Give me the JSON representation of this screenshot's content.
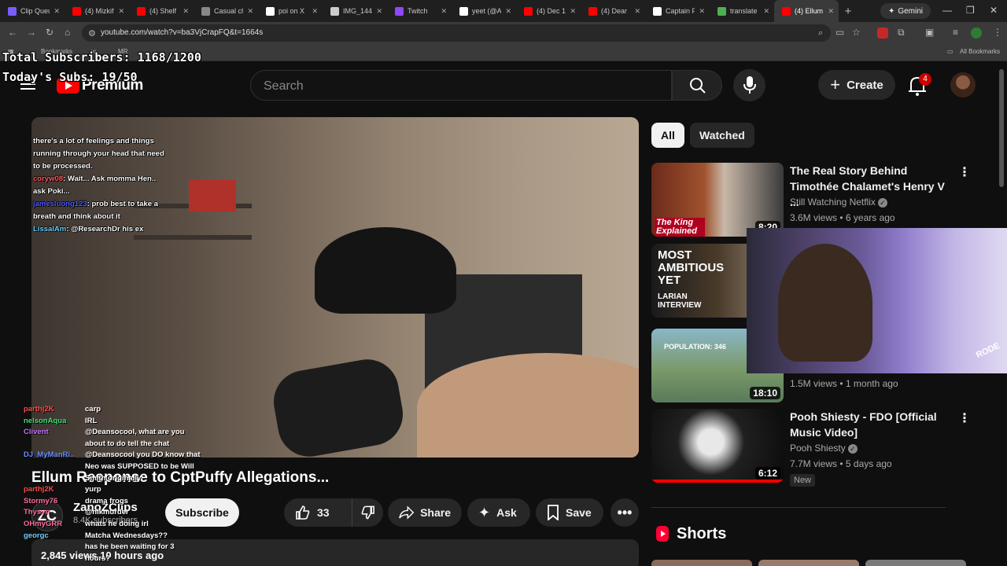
{
  "browser": {
    "tabs": [
      {
        "label": "Clip Queue",
        "color": "#7b5cff"
      },
      {
        "label": "(4) Mizkif",
        "color": "#ff0000"
      },
      {
        "label": "(4) Shelf",
        "color": "#ff0000"
      },
      {
        "label": "Casual ch",
        "color": "#888888"
      },
      {
        "label": "poi on X",
        "color": "#ffffff"
      },
      {
        "label": "IMG_144",
        "color": "#cccccc"
      },
      {
        "label": "Twitch",
        "color": "#9146ff"
      },
      {
        "label": "yeet (@A",
        "color": "#ffffff"
      },
      {
        "label": "(4) Dec 1",
        "color": "#ff0000"
      },
      {
        "label": "(4) Dear",
        "color": "#ff0000"
      },
      {
        "label": "Captain F",
        "color": "#ffffff"
      },
      {
        "label": "translate",
        "color": "#4caf50"
      },
      {
        "label": "(4) Ellum",
        "color": "#ff0000"
      }
    ],
    "active_tab": 12,
    "new_tab": "+",
    "gemini": "Gemini",
    "url": "youtube.com/watch?v=ba3VjCrapFQ&t=1664s",
    "bookmarks": [
      "Bookmarks",
      "w",
      "MR"
    ],
    "all_bookmarks": "All Bookmarks"
  },
  "overlay": {
    "total_subs": "Total Subscribers: 1168/1200",
    "todays_subs": "Today's Subs: 19/50",
    "chat_top": [
      {
        "user": "",
        "msg": "there's a lot of feelings and things running through your head that need to be processed.",
        "ucolor": ""
      },
      {
        "user": "coryw08",
        "msg": ": Wait... Ask momma Hen.. ask Poki...",
        "ucolor": "u"
      },
      {
        "user": "jamesluong123",
        "msg": ": prob best to take a breath and think about it",
        "ucolor": "u2"
      },
      {
        "user": "LissalAm",
        "msg": ": @ResearchDr his ex",
        "ucolor": "u3"
      }
    ],
    "chat_bottom": [
      {
        "user": "parthj2K",
        "msg": "carp",
        "color": "#ff4a4a"
      },
      {
        "user": "nelsonAqua",
        "msg": "IRL",
        "color": "#3fdc7a"
      },
      {
        "user": "Clivent",
        "msg": "@Deansocool, what are you",
        "color": "#c070ff"
      },
      {
        "user": "",
        "msg": "about to do tell the chat",
        "color": "#ffffff"
      },
      {
        "user": "DJ_MyManRi..",
        "msg": "@Deansocool you DO know that",
        "color": "#6a8cff"
      },
      {
        "user": "",
        "msg": "Neo was SUPPOSED to be Will",
        "color": "#ffffff"
      },
      {
        "user": "",
        "msg": "Smith originally",
        "color": "#ffffff"
      },
      {
        "user": "parthj2K",
        "msg": "yurp",
        "color": "#ff4a4a"
      },
      {
        "user": "Stormy76",
        "msg": "drama frogs",
        "color": "#ff6aa0"
      },
      {
        "user": "Thysyn",
        "msg": "@nikmurder",
        "color": "#ff6aa0"
      },
      {
        "user": "OHmyGRR",
        "msg": "whats he doing irl",
        "color": "#ff6aa0"
      },
      {
        "user": "georgc",
        "msg": "Matcha Wednesdays??",
        "color": "#6fd0ff"
      },
      {
        "user": "",
        "msg": "has he been waiting for 3",
        "color": "#ffffff"
      },
      {
        "user": "",
        "msg": "hours?",
        "color": "#ffffff"
      }
    ]
  },
  "youtube": {
    "brand": "Premium",
    "search_placeholder": "Search",
    "create": "Create",
    "notif_count": "4",
    "video": {
      "title": "Ellum Response to CptPuffy Allegations...",
      "channel": "ZanoZClips",
      "channel_initials": "ZC",
      "subscribers": "8.4K subscribers",
      "subscribe": "Subscribe",
      "likes": "33",
      "share": "Share",
      "ask": "Ask",
      "save": "Save",
      "views_time": "2,845 views  10 hours ago"
    },
    "chips": {
      "all": "All",
      "watched": "Watched"
    },
    "related": [
      {
        "title": "The Real Story Behind Timothée Chalamet's Henry V ...",
        "channel": "Still Watching Netflix",
        "verified": true,
        "meta": "3.6M views • 6 years ago",
        "duration": "8:20",
        "thumb_text": "The King Explained"
      },
      {
        "title": "",
        "channel": "",
        "verified": false,
        "meta": "",
        "duration": "",
        "thumb_text": "MOST AMBITIOUS YET",
        "thumb_sub": "LARIAN INTERVIEW"
      },
      {
        "title": "",
        "channel": "",
        "verified": false,
        "meta": "1.5M views • 1 month ago",
        "duration": "18:10",
        "thumb_text": "POPULATION: 346"
      },
      {
        "title": "Pooh Shiesty - FDO [Official Music Video]",
        "channel": "Pooh Shiesty",
        "verified": true,
        "meta": "7.7M views • 5 days ago",
        "duration": "6:12",
        "badge": "New"
      }
    ],
    "shorts": "Shorts",
    "webcam_label": "RODE"
  }
}
